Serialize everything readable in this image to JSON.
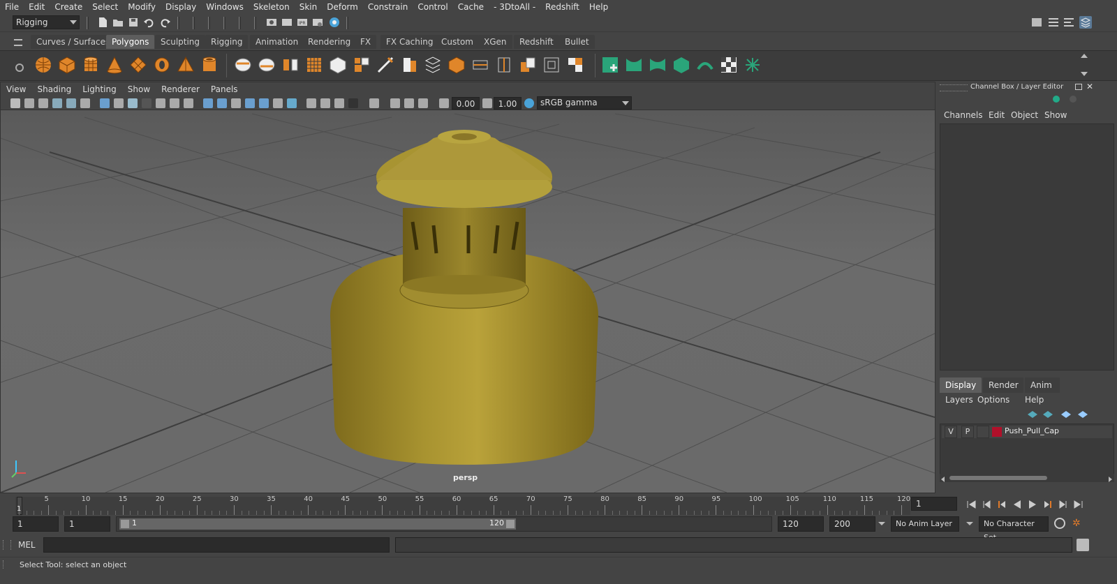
{
  "menubar": {
    "items": [
      "File",
      "Edit",
      "Create",
      "Select",
      "Modify",
      "Display",
      "Windows",
      "Skeleton",
      "Skin",
      "Deform",
      "Constrain",
      "Control",
      "Cache",
      "- 3DtoAll -",
      "Redshift",
      "Help"
    ]
  },
  "statusline": {
    "menuset": "Rigging"
  },
  "shelf": {
    "tabs": [
      "Curves / Surfaces",
      "Polygons",
      "Sculpting",
      "Rigging",
      "Animation",
      "Rendering",
      "FX",
      "FX Caching",
      "Custom",
      "XGen",
      "Redshift",
      "Bullet"
    ],
    "active_tab": "Polygons"
  },
  "viewport": {
    "menu": [
      "View",
      "Shading",
      "Lighting",
      "Show",
      "Renderer",
      "Panels"
    ],
    "exposure": "0.00",
    "gamma": "1.00",
    "color_space": "sRGB gamma",
    "camera_label": "persp"
  },
  "channel_box": {
    "title": "Channel Box / Layer Editor",
    "menu": [
      "Channels",
      "Edit",
      "Object",
      "Show"
    ]
  },
  "layer_editor": {
    "tabs": [
      "Display",
      "Render",
      "Anim"
    ],
    "active_tab": "Display",
    "menu": [
      "Layers",
      "Options",
      "Help"
    ],
    "layers": [
      {
        "v": "V",
        "p": "P",
        "name": "Push_Pull_Cap",
        "color": "#b0102a"
      }
    ]
  },
  "timeline": {
    "ticks": [
      "5",
      "10",
      "15",
      "20",
      "25",
      "30",
      "35",
      "40",
      "45",
      "50",
      "55",
      "60",
      "65",
      "70",
      "75",
      "80",
      "85",
      "90",
      "95",
      "100",
      "105",
      "110",
      "115",
      "120"
    ],
    "current_frame_marker": "1",
    "current_frame": "1"
  },
  "range": {
    "start": "1",
    "playback_start": "1",
    "slider_start": "1",
    "slider_end": "120",
    "playback_end": "120",
    "end": "200",
    "anim_layer": "No Anim Layer",
    "character_set": "No Character Set"
  },
  "cmdline": {
    "label": "MEL"
  },
  "helpline": {
    "text": "Select Tool: select an object"
  },
  "colors": {
    "model": "#a08a2c",
    "layer_swatch": "#b0102a",
    "accent": "#4aa3d8"
  }
}
